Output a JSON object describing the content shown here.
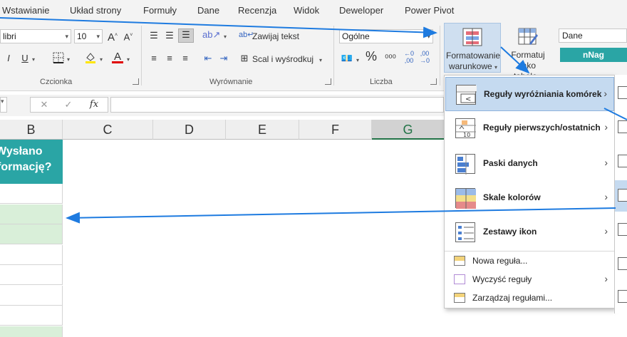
{
  "tabs": [
    "Wstawianie",
    "Układ strony",
    "Formuły",
    "Dane",
    "Recenzja",
    "Widok",
    "Deweloper",
    "Power Pivot"
  ],
  "font": {
    "name": "libri",
    "size": "10",
    "group_label": "Czcionka"
  },
  "alignment": {
    "wrap_text": "Zawijaj tekst",
    "merge_center": "Scal i wyśrodkuj",
    "group_label": "Wyrównanie"
  },
  "number": {
    "format": "Ogólne",
    "group_label": "Liczba",
    "percent": "%"
  },
  "styles": {
    "conditional_formatting": [
      "Formatowanie",
      "warunkowe"
    ],
    "format_as_table": [
      "Formatuj jako",
      "tabelę"
    ],
    "cell_style_1": "Dane",
    "cell_style_2": "nNag"
  },
  "formula_bar": {
    "fx": "fx"
  },
  "columns": [
    "B",
    "C",
    "D",
    "E",
    "F",
    "G"
  ],
  "header_cell": [
    "Wysłano",
    "formację?"
  ],
  "rows": [
    {
      "green": false
    },
    {
      "green": true
    },
    {
      "green": true
    },
    {
      "green": false
    },
    {
      "green": false
    },
    {
      "green": false
    },
    {
      "green": false
    },
    {
      "green": true
    }
  ],
  "menu": {
    "items": [
      "Reguły wyróżniania komórek",
      "Reguły pierwszych/ostatnich",
      "Paski danych",
      "Skale kolorów",
      "Zestawy ikon"
    ],
    "small_items": [
      "Nowa reguła...",
      "Wyczyść reguły",
      "Zarządzaj regułami..."
    ],
    "submenu_arrow": "›"
  },
  "colors": {
    "accent_blue": "#1e7be0",
    "header_teal": "#2aa5a5",
    "cell_green": "#d9efd9",
    "style_teal": "#2aa5a5",
    "excel_green": "#217346"
  }
}
